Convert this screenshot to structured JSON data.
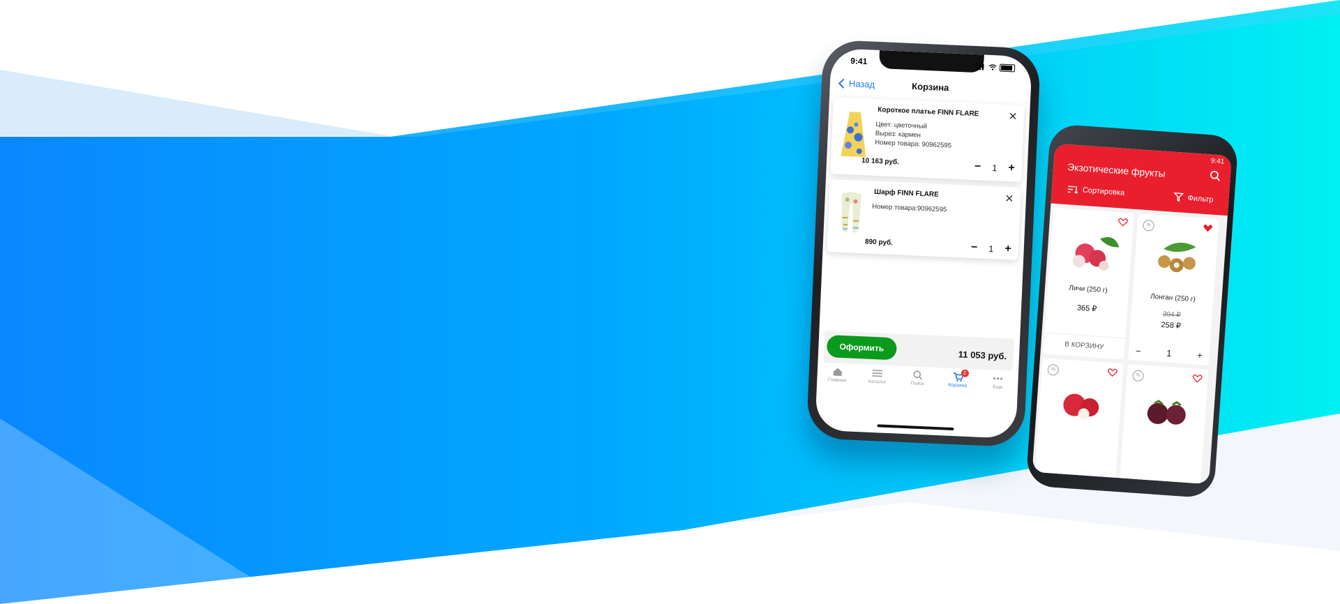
{
  "ios": {
    "status_time": "9:41",
    "nav": {
      "back_label": "Назад",
      "title": "Корзина"
    },
    "items": [
      {
        "name": "Короткое платье FINN FLARE",
        "meta": [
          "Цвет: цветочный",
          "Вырез: кармен",
          "Номер товара: 90962595"
        ],
        "price": "10 163 руб.",
        "qty": "1",
        "minus": "−",
        "plus": "+"
      },
      {
        "name": "Шарф FINN FLARE",
        "meta": [
          "Номер товара:90962595"
        ],
        "price": "890 руб.",
        "qty": "1",
        "minus": "−",
        "plus": "+"
      }
    ],
    "checkout_label": "Оформить",
    "total": "11 053 руб.",
    "tabs": [
      {
        "label": "Главная",
        "icon": "home-icon"
      },
      {
        "label": "Каталог",
        "icon": "menu-icon"
      },
      {
        "label": "Поиск",
        "icon": "search-icon"
      },
      {
        "label": "Корзина",
        "icon": "cart-icon",
        "badge": "2",
        "active": true
      },
      {
        "label": "Еще",
        "icon": "more-icon"
      }
    ]
  },
  "android": {
    "status_time": "9:41",
    "title": "Экзотические фрукты",
    "sort_label": "Сортировка",
    "filter_label": "Фильтр",
    "products": [
      {
        "name": "Личи (250 г)",
        "price": "365 ₽",
        "old_price": "",
        "action": "В КОРЗИНУ",
        "favorite": false
      },
      {
        "name": "Лонган (250 г)",
        "price": "258 ₽",
        "old_price": "394 ₽",
        "qty": "1",
        "minus": "−",
        "plus": "+",
        "favorite": true
      }
    ]
  },
  "colors": {
    "ios_accent": "#1a7ef2",
    "checkout": "#0a9a1d",
    "android_primary": "#ea1f2e",
    "bg_blue": "#0a8cff",
    "bg_cyan": "#00e8f2"
  }
}
